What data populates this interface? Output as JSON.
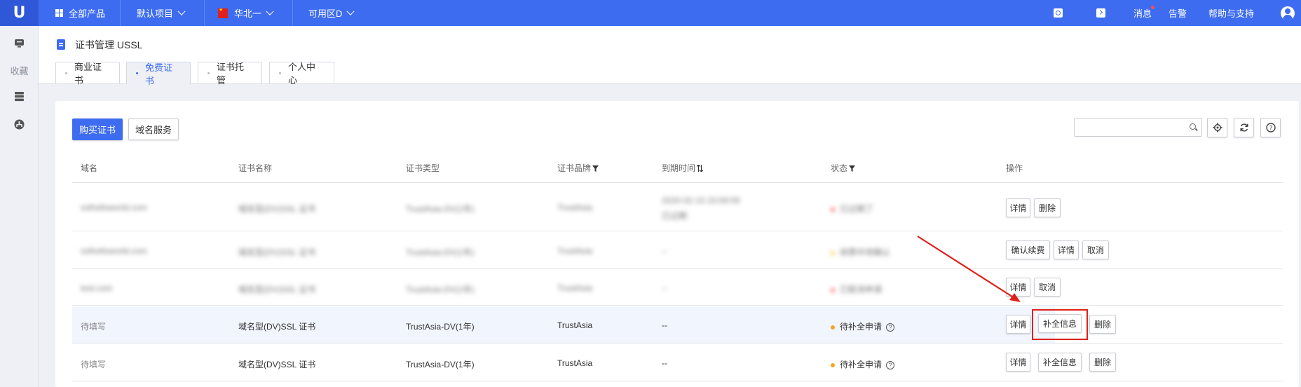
{
  "topbar": {
    "all_products": "全部产品",
    "project": "默认项目",
    "region": "华北一",
    "zone": "可用区D",
    "messages": "消息",
    "alarms": "告警",
    "help": "帮助与支持"
  },
  "sidebar": {
    "favorites": "收藏"
  },
  "page": {
    "title": "证书管理 USSL",
    "tabs": [
      {
        "label": "商业证书"
      },
      {
        "label": "免费证书"
      },
      {
        "label": "证书托管"
      },
      {
        "label": "个人中心"
      }
    ]
  },
  "toolbar": {
    "buy_label": "购买证书",
    "domain_service_label": "域名服务",
    "search_placeholder": ""
  },
  "table": {
    "headers": {
      "domain": "域名",
      "cert_name": "证书名称",
      "cert_type": "证书类型",
      "brand": "证书品牌",
      "expire": "到期时间",
      "status": "状态",
      "ops": "操作"
    },
    "rows": [
      {
        "domain": "sslhelloworld.com",
        "cert_name": "域名型(DV)SSL 证书",
        "cert_type": "TrustAsia-DV(1年)",
        "brand": "TrustAsia",
        "expire_line1": "2020-02-15 23:59:59",
        "expire_line2": "已过期",
        "status": "已过期了",
        "actions": [
          "详情",
          "删除"
        ]
      },
      {
        "domain": "sslhelloworld.com",
        "cert_name": "域名型(DV)SSL 证书",
        "cert_type": "TrustAsia-DV(1年)",
        "brand": "TrustAsia",
        "expire": "--",
        "status": "续费中待确认",
        "actions": [
          "确认续费",
          "详情",
          "取消"
        ]
      },
      {
        "domain": "test.com",
        "cert_name": "域名型(DV)SSL 证书",
        "cert_type": "TrustAsia-DV(1年)",
        "brand": "TrustAsia",
        "expire": "--",
        "status": "已取消申请",
        "actions": [
          "详情",
          "取消"
        ]
      },
      {
        "domain": "待填写",
        "cert_name": "域名型(DV)SSL 证书",
        "cert_type": "TrustAsia-DV(1年)",
        "brand": "TrustAsia",
        "expire": "--",
        "status": "待补全申请",
        "actions": [
          "详情",
          "补全信息",
          "删除"
        ]
      },
      {
        "domain": "待填写",
        "cert_name": "域名型(DV)SSL 证书",
        "cert_type": "TrustAsia-DV(1年)",
        "brand": "TrustAsia",
        "expire": "--",
        "status": "待补全申请",
        "actions": [
          "详情",
          "补全信息",
          "删除"
        ]
      }
    ]
  },
  "colors": {
    "primary": "#3d6cf0",
    "status_pending": "#f5a623",
    "status_red": "#f56c6c",
    "status_yellow": "#f8d35a",
    "annotation": "#e0201b"
  }
}
